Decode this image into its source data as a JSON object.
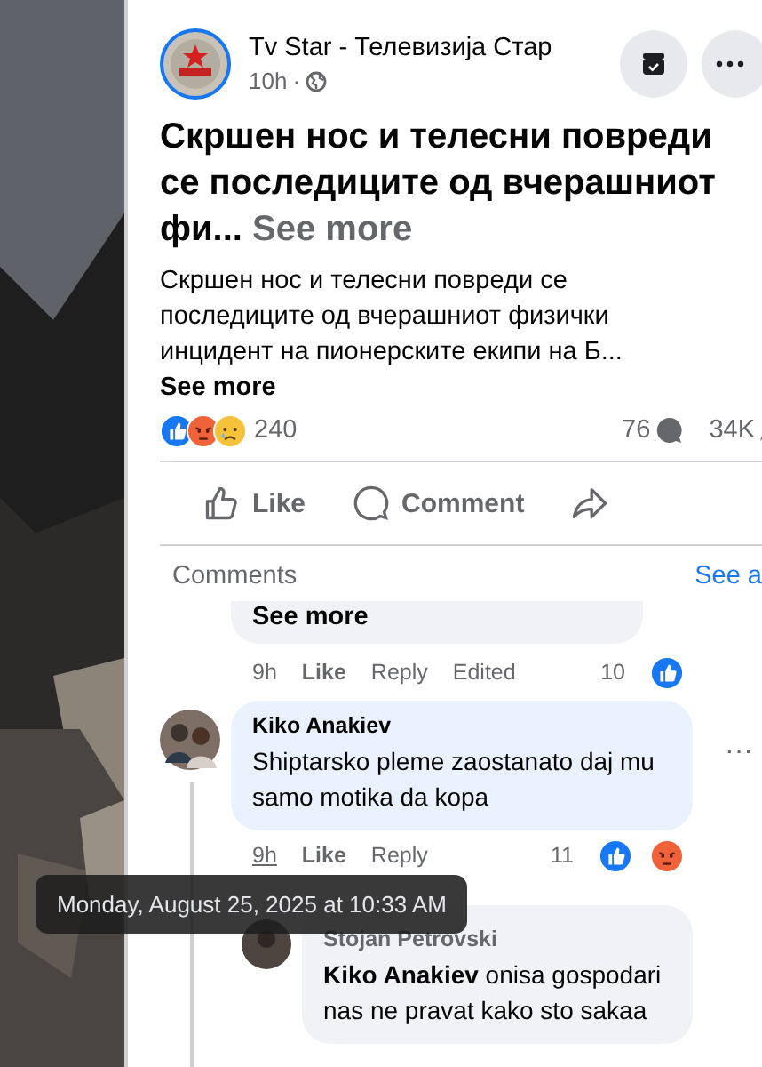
{
  "post": {
    "page_name": "Tv Star - Телевизија Стар",
    "time": "10h",
    "separator": "·",
    "title": "Скршен нос и телесни повреди се последиците од вчерашниот фи...",
    "title_more": "See more",
    "body": "Скршен нос и телесни повреди се последиците од вчерашниот физички инцидент на пионерските екипи на Б...",
    "body_more": "See more",
    "reactions": [
      {
        "kind": "like"
      },
      {
        "kind": "angry"
      },
      {
        "kind": "sad"
      }
    ],
    "reaction_count": "240",
    "comment_count": "76",
    "share_count": "34K"
  },
  "actions": [
    {
      "kind": "like",
      "label": "Like"
    },
    {
      "kind": "comment",
      "label": "Comment"
    },
    {
      "kind": "share"
    }
  ],
  "comments_header": {
    "title": "Comments",
    "link": "See a"
  },
  "comments": [
    {
      "kind": "cut",
      "more": "See more",
      "time": "9h",
      "like": "Like",
      "reply": "Reply",
      "edited": "Edited",
      "count": "10",
      "reactions": [
        {
          "kind": "like"
        }
      ]
    },
    {
      "kind": "full",
      "author": "Kiko Anakiev",
      "text": "Shiptarsko pleme zaostanato daj mu samo motika da kopa",
      "time": "9h",
      "like": "Like",
      "reply": "Reply",
      "count": "11",
      "reactions": [
        {
          "kind": "like"
        },
        {
          "kind": "angry"
        }
      ],
      "menu": "···"
    },
    {
      "kind": "reply",
      "author": "Stojan Petrovski",
      "mention": "Kiko Anakiev",
      "text": "onisa gospodari nas ne pravat kako sto sakaa"
    }
  ],
  "tooltip": "Monday, August 25, 2025 at 10:33 AM"
}
